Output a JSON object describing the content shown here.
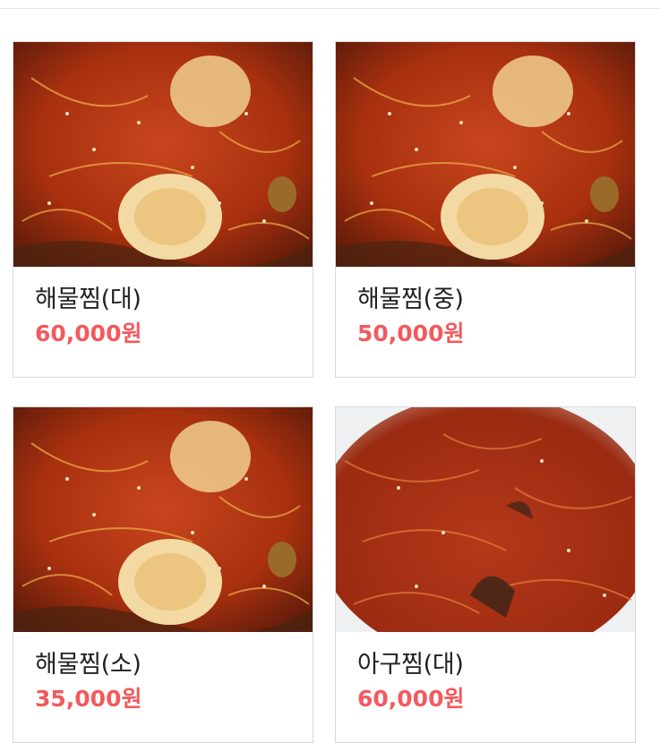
{
  "menu": {
    "items": [
      {
        "name": "해물찜(대)",
        "price": "60,000원",
        "image": "seafood-steam-photo"
      },
      {
        "name": "해물찜(중)",
        "price": "50,000원",
        "image": "seafood-steam-photo"
      },
      {
        "name": "해물찜(소)",
        "price": "35,000원",
        "image": "seafood-steam-photo"
      },
      {
        "name": "아구찜(대)",
        "price": "60,000원",
        "image": "monkfish-steam-photo"
      }
    ]
  },
  "colors": {
    "price": "#f25a5e",
    "name": "#222222",
    "border": "#d9d9d9"
  }
}
